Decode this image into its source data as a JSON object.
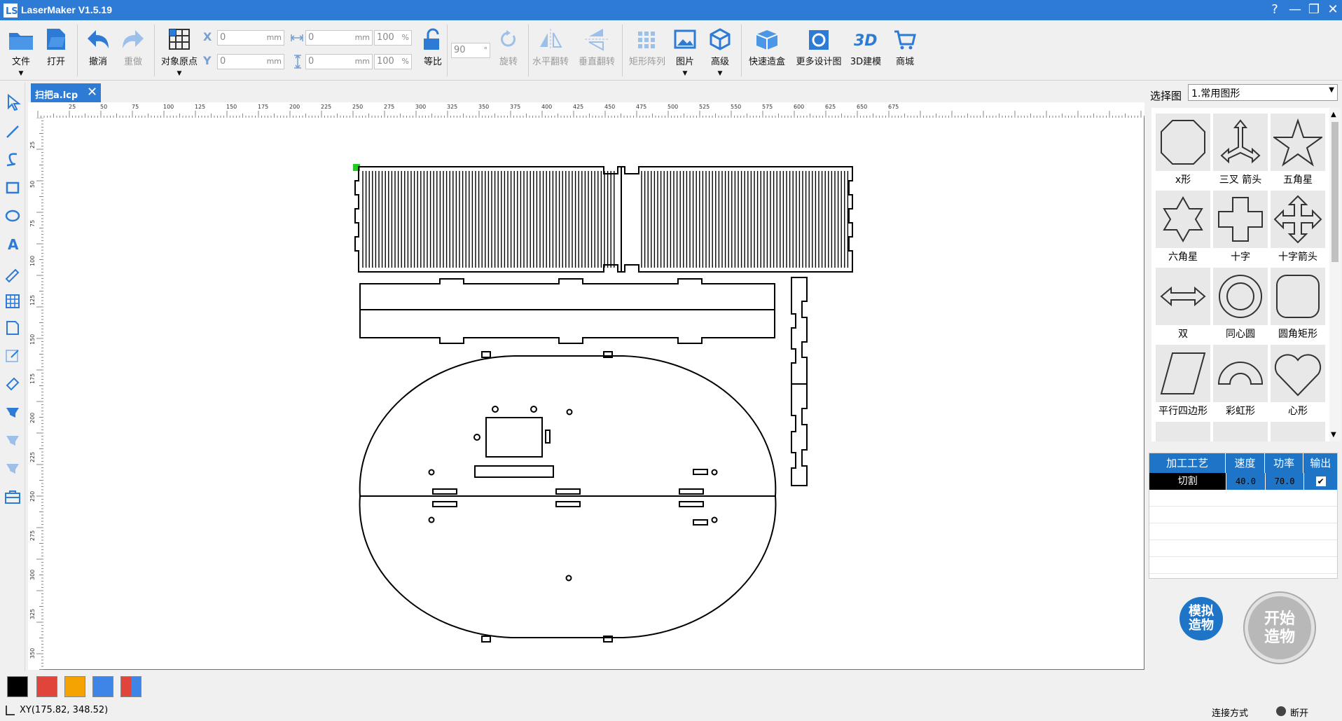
{
  "app": {
    "title": "LaserMaker V1.5.19"
  },
  "window_controls": {
    "help": "?",
    "minimize": "—",
    "restore": "❐",
    "close": "✕"
  },
  "toolbar": {
    "file": "文件",
    "open": "打开",
    "undo": "撤消",
    "redo": "重做",
    "origin": "对象原点",
    "x_label": "X",
    "y_label": "Y",
    "x_value": "0",
    "y_value": "0",
    "width_value": "0",
    "height_value": "0",
    "unit": "mm",
    "width_pct": "100",
    "height_pct": "100",
    "pct_sign": "%",
    "proportional": "等比",
    "rotate_value": "90",
    "rotate_unit": "°",
    "rotate": "旋转",
    "flip_h": "水平翻转",
    "flip_v": "垂直翻转",
    "rect_array": "矩形阵列",
    "image": "图片",
    "advanced": "高级",
    "quick_box": "快速造盒",
    "more_designs": "更多设计图",
    "model3d": "3D建模",
    "store": "商城"
  },
  "document": {
    "tab_name": "扫把a.lcp"
  },
  "ruler": {
    "h_ticks": [
      "25",
      "50",
      "75",
      "100",
      "125",
      "150",
      "175",
      "200",
      "225",
      "250",
      "275",
      "300",
      "325",
      "350",
      "375",
      "400",
      "425",
      "450",
      "475",
      "500",
      "525",
      "550",
      "575",
      "600",
      "625",
      "650",
      "675"
    ],
    "v_ticks": [
      "25",
      "50",
      "75",
      "100",
      "125",
      "150",
      "175",
      "200",
      "225",
      "250",
      "275",
      "300",
      "325",
      "350"
    ]
  },
  "shapes_panel": {
    "label": "选择图",
    "dropdown_value": "1.常用图形",
    "items": [
      {
        "label": "x形",
        "icon": "x-shape-icon"
      },
      {
        "label": "三叉 箭头",
        "icon": "trident-arrow-icon"
      },
      {
        "label": "五角星",
        "icon": "star5-icon"
      },
      {
        "label": "六角星",
        "icon": "star6-icon"
      },
      {
        "label": "十字",
        "icon": "cross-icon"
      },
      {
        "label": "十字箭头",
        "icon": "cross-arrow-icon"
      },
      {
        "label": "双",
        "icon": "double-arrow-icon"
      },
      {
        "label": "同心圆",
        "icon": "concentric-icon"
      },
      {
        "label": "圆角矩形",
        "icon": "rounded-rect-icon"
      },
      {
        "label": "平行四边形",
        "icon": "parallelogram-icon"
      },
      {
        "label": "彩虹形",
        "icon": "rainbow-icon"
      },
      {
        "label": "心形",
        "icon": "heart-icon"
      }
    ]
  },
  "process_table": {
    "headers": [
      "加工工艺",
      "速度",
      "功率",
      "输出"
    ],
    "rows": [
      {
        "process": "切割",
        "speed": "40.0",
        "power": "70.0",
        "output": true
      }
    ]
  },
  "actions": {
    "simulate": "模拟\n造物",
    "start": "开始\n造物"
  },
  "colors": {
    "accent": "#2e7bd6",
    "swatches": [
      "#000000",
      "#e0443a",
      "#f5a300",
      "#3f85e8",
      "multi"
    ]
  },
  "status": {
    "coords": "XY(175.82, 348.52)",
    "connection": "连接方式",
    "state": "断开"
  }
}
